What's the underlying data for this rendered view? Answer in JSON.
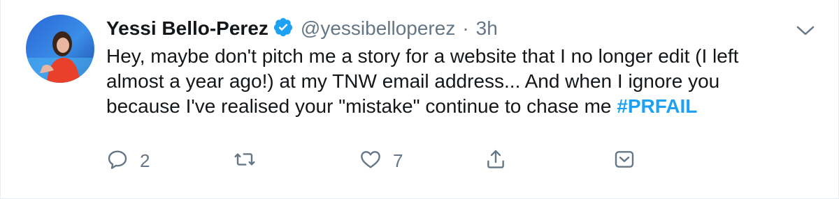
{
  "tweet": {
    "author_name": "Yessi Bello-Perez",
    "verified_icon": "verified-badge-icon",
    "handle": "@yessibelloperez",
    "separator": "·",
    "time": "3h",
    "text_lines": [
      "Hey, maybe don't pitch me a story for a website that I no longer edit (I left",
      "almost a year ago!) at my TNW email address... And when I ignore you",
      "because I've realised your \"mistake\" continue to chase me "
    ],
    "hashtag": "#PRFAIL"
  },
  "actions": {
    "reply": {
      "icon": "reply-icon",
      "count": "2"
    },
    "retweet": {
      "icon": "retweet-icon",
      "count": ""
    },
    "like": {
      "icon": "heart-icon",
      "count": "7"
    },
    "share": {
      "icon": "share-icon"
    },
    "dm": {
      "icon": "message-icon"
    }
  },
  "colors": {
    "accent": "#1da1f2",
    "muted": "#657786",
    "text": "#14171a",
    "border": "#e6ecf0"
  }
}
